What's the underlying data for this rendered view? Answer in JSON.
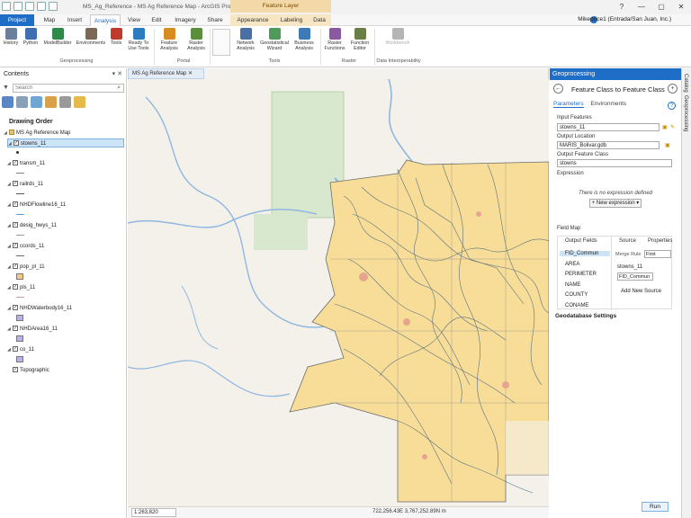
{
  "window": {
    "title": "MS_Ag_Reference - MS Ag Reference Map - ArcGIS Pro",
    "contextual_tab_header": "Feature Layer",
    "user": "Mikeprice1 (Entrada/San Juan, Inc.)",
    "controls": {
      "help": "?",
      "minimize": "—",
      "maximize": "▢",
      "close": "✕"
    }
  },
  "tabs": [
    "Project",
    "Map",
    "Insert",
    "Analysis",
    "View",
    "Edit",
    "Imagery",
    "Share",
    "Appearance",
    "Labeling",
    "Data"
  ],
  "ribbon": {
    "buttons": [
      {
        "label": "History",
        "color": "#6b7f9a"
      },
      {
        "label": "Python",
        "color": "#3f6fb0"
      },
      {
        "label": "ModelBuilder",
        "color": "#2f8a4a"
      },
      {
        "label": "Environments",
        "color": "#7a6a55"
      },
      {
        "label": "Tools",
        "color": "#c03a2b"
      },
      {
        "label": "Ready To Use Tools",
        "color": "#2b7bbf"
      },
      {
        "label": "Feature Analysis",
        "color": "#d88b1f"
      },
      {
        "label": "Raster Analysis",
        "color": "#5a8f3d"
      },
      {
        "label": "Network Analysis",
        "color": "#4a6fa5"
      },
      {
        "label": "Geostatistical Wizard",
        "color": "#4e9a5a"
      },
      {
        "label": "Business Analysis",
        "color": "#3d7ab8"
      },
      {
        "label": "Raster Functions",
        "color": "#8a5aa0"
      },
      {
        "label": "Function Editor",
        "color": "#6a7f45"
      },
      {
        "label": "Workbench",
        "color": "#b5b5b5"
      }
    ],
    "groups": [
      "Geoprocessing",
      "Portal",
      "Tools",
      "Raster",
      "Data Interoperability"
    ]
  },
  "contents": {
    "title": "Contents",
    "search_placeholder": "Search",
    "drawing_order_label": "Drawing Order",
    "map_name": "MS Ag Reference Map",
    "layers": [
      {
        "name": "stowns_11",
        "selected": true,
        "symbol": "dot",
        "color": "#333333"
      },
      {
        "name": "transm_11",
        "symbol": "line",
        "color": "#7f7f7f"
      },
      {
        "name": "railrds_11",
        "symbol": "line",
        "color": "#555555"
      },
      {
        "name": "NHDFlowline16_11",
        "symbol": "line",
        "color": "#5b9bd5"
      },
      {
        "name": "desig_hwys_11",
        "symbol": "line",
        "color": "#9a9a9a"
      },
      {
        "name": "ccords_11",
        "symbol": "line",
        "color": "#6d6d6d"
      },
      {
        "name": "pop_pl_11",
        "symbol": "fill",
        "color": "#f4c98a"
      },
      {
        "name": "pls_11",
        "symbol": "line",
        "color": "#c5a0a0"
      },
      {
        "name": "NHDWaterbody16_11",
        "symbol": "fill",
        "color": "#b7b3e8"
      },
      {
        "name": "NHDArea16_11",
        "symbol": "fill",
        "color": "#b7b3e8"
      },
      {
        "name": "co_11",
        "symbol": "fill",
        "color": "#b7b3e8"
      },
      {
        "name": "Topographic",
        "symbol": "none"
      }
    ]
  },
  "map": {
    "tab_label": "MS Ag Reference Map",
    "scale": "1:263,820",
    "coordinates": "722,256.43E 3,767,252.89N m"
  },
  "geoprocessing": {
    "pane_title": "Geoprocessing",
    "tool_title": "Feature Class to Feature Class",
    "tabs": [
      "Parameters",
      "Environments"
    ],
    "input_features_label": "Input Features",
    "input_features_value": "stowns_11",
    "output_location_label": "Output Location",
    "output_location_value": "MARIS_Bolivar.gdb",
    "output_fc_label": "Output Feature Class",
    "output_fc_value": "stowns",
    "expression_label": "Expression",
    "expression_msg": "There is no expression defined",
    "new_expression": "New expression",
    "field_map_label": "Field Map",
    "output_fields_label": "Output Fields",
    "source_label": "Source",
    "properties_label": "Properties",
    "fields": [
      "FID_Commun",
      "AREA",
      "PERIMETER",
      "NAME",
      "COUNTY",
      "CONAME"
    ],
    "merge_rule_label": "Merge Rule",
    "merge_rule_value": "First",
    "source_layer": "stowns_11",
    "source_field": "FID_Commun",
    "add_new_source": "Add New Source",
    "geodb_settings": "Geodatabase Settings",
    "run": "Run"
  },
  "side_tabs": [
    "Catalog",
    "Geoprocessing"
  ]
}
